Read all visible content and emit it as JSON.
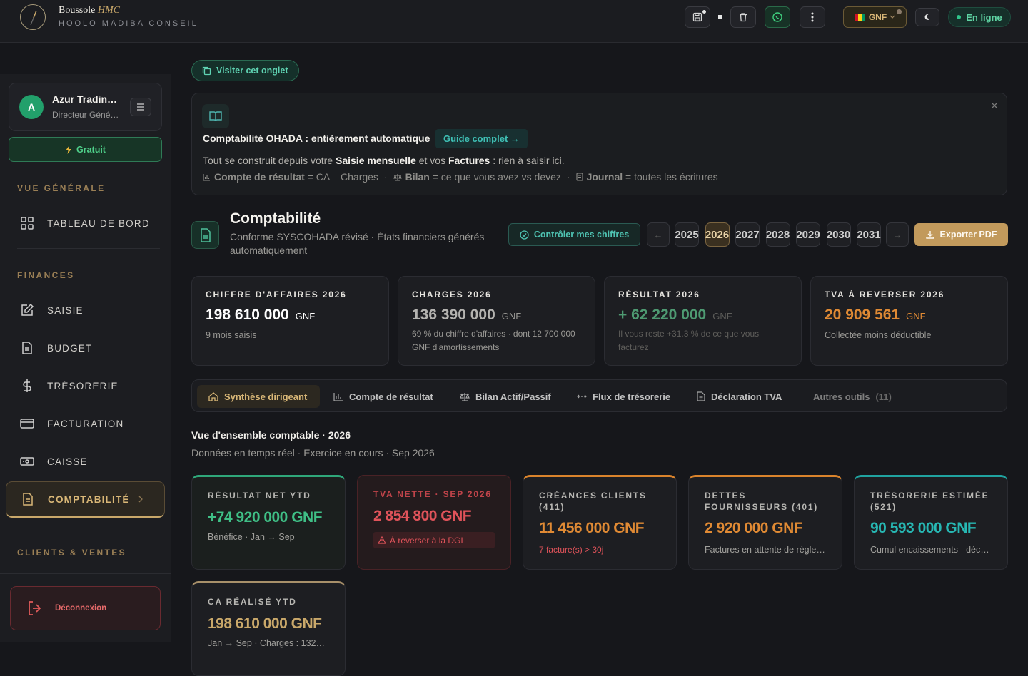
{
  "topbar": {
    "brand_name": "Boussole",
    "brand_accent": "HMC",
    "brand_sub": "HOOLO MADIBA CONSEIL",
    "currency": "GNF",
    "status": "En ligne"
  },
  "sidebar": {
    "profile": {
      "initial": "A",
      "name": "Azur Tradin…",
      "role": "Directeur Géné…"
    },
    "plan_label": "Gratuit",
    "sections": {
      "overview": "VUE GÉNÉRALE",
      "finances": "FINANCES",
      "clients": "CLIENTS & VENTES"
    },
    "items": {
      "dashboard": "TABLEAU DE BORD",
      "saisie": "SAISIE",
      "budget": "BUDGET",
      "tresorerie": "TRÉSORERIE",
      "facturation": "FACTURATION",
      "caisse": "CAISSE",
      "comptabilite": "COMPTABILITÉ"
    },
    "logout": "Déconnexion"
  },
  "main": {
    "visit_tab": "Visiter cet onglet",
    "info": {
      "title": "Comptabilité OHADA : entièrement automatique",
      "guide": "Guide complet →",
      "line1_pre": "Tout se construit depuis votre",
      "line1_b1": "Saisie mensuelle",
      "line1_mid": "et vos",
      "line1_b2": "Factures",
      "line1_post": ": rien à saisir ici.",
      "h1_b": "Compte de résultat",
      "h1": "= CA – Charges",
      "h2_b": "Bilan",
      "h2": "= ce que vous avez vs devez",
      "h3_b": "Journal",
      "h3": "= toutes les écritures"
    },
    "header": {
      "title": "Comptabilité",
      "subtitle": "Conforme SYSCOHADA révisé · États financiers générés automatiquement",
      "check_btn": "Contrôler mes chiffres",
      "years": [
        "2025",
        "2026",
        "2027",
        "2028",
        "2029",
        "2030",
        "2031"
      ],
      "selected_year": "2026",
      "export_btn": "Exporter PDF"
    },
    "kpis": [
      {
        "title": "CHIFFRE D'AFFAIRES 2026",
        "value": "198 610 000",
        "unit": "GNF",
        "note": "9 mois saisis",
        "color": "#ffffff"
      },
      {
        "title": "CHARGES 2026",
        "value": "136 390 000",
        "unit": "GNF",
        "note": "69 % du chiffre d'affaires · dont 12 700 000 GNF d'amortissements",
        "color": "#b4b3b0"
      },
      {
        "title": "RÉSULTAT 2026",
        "value": "+ 62 220 000",
        "unit": "GNF",
        "note": "Il vous reste +31.3 % de ce que vous facturez",
        "color": "#4e9a72"
      },
      {
        "title": "TVA À REVERSER 2026",
        "value": "20 909 561",
        "unit": "GNF",
        "note": "Collectée moins déductible",
        "color": "#e08a34"
      }
    ],
    "tabs": [
      {
        "label": "Synthèse dirigeant"
      },
      {
        "label": "Compte de résultat"
      },
      {
        "label": "Bilan Actif/Passif"
      },
      {
        "label": "Flux de trésorerie"
      },
      {
        "label": "Déclaration TVA"
      },
      {
        "label": "Autres outils",
        "count": "(11)"
      }
    ],
    "overview": {
      "title": "Vue d'ensemble comptable · 2026",
      "subtitle": "Données en temps réel · Exercice en cours · Sep 2026"
    },
    "cards": [
      {
        "title": "RÉSULTAT NET YTD",
        "value": "+74 920 000 GNF",
        "note": "Bénéfice · Jan → Sep"
      },
      {
        "title": "TVA NETTE · SEP 2026",
        "value": "2 854 800 GNF",
        "note": "À reverser à la DGI"
      },
      {
        "title": "CRÉANCES CLIENTS (411)",
        "value": "11 456 000 GNF",
        "note": "7 facture(s) > 30j"
      },
      {
        "title": "DETTES FOURNISSEURS (401)",
        "value": "2 920 000 GNF",
        "note": "Factures en attente de règle…"
      },
      {
        "title": "TRÉSORERIE ESTIMÉE (521)",
        "value": "90 593 000 GNF",
        "note": "Cumul encaissements - déc…"
      },
      {
        "title": "CA RÉALISÉ YTD",
        "value": "198 610 000 GNF",
        "note": "Jan → Sep · Charges : 132…"
      }
    ]
  }
}
